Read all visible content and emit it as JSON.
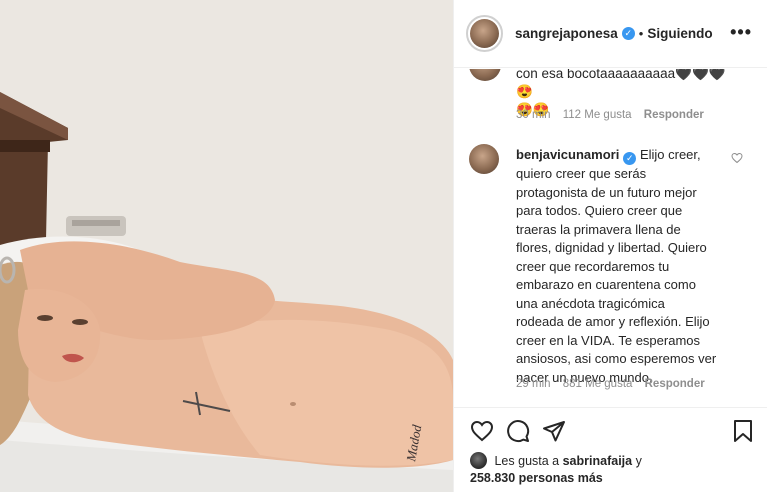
{
  "header": {
    "username": "sangrejaponesa",
    "separator": "•",
    "follow_status": "Siguiendo",
    "more_icon": "more-horizontal-icon"
  },
  "comment1": {
    "text_line1": "con esa bocotaaaaaaaaaa🖤🖤🖤😍",
    "text_line2": "😍😍",
    "time": "30 min",
    "likes": "112 Me gusta",
    "reply": "Responder"
  },
  "comment2": {
    "username": "benjavicunamori",
    "text_first": "Elijo creer,",
    "text_lines": [
      "quiero creer que serás",
      "protagonista de un futuro mejor",
      "para todos. Quiero creer que",
      "traeras la primavera llena de",
      "flores, dignidad y libertad. Quiero",
      "creer que recordaremos tu",
      "embarazo en cuarentena como",
      "una anécdota tragicómica",
      "rodeada de amor y reflexión. Elijo",
      "creer en la VIDA. Te esperamos",
      "ansiosos, asi como esperemos ver",
      "nacer un nuevo mundo."
    ],
    "time": "29 min",
    "likes": "881 Me gusta",
    "reply": "Responder"
  },
  "footer": {
    "likes_prefix": "Les gusta a",
    "likes_user": "sabrinafaija",
    "likes_y": "y",
    "likes_count": "258.830 personas más"
  },
  "photo": {
    "tattoo_text": "Madod"
  }
}
